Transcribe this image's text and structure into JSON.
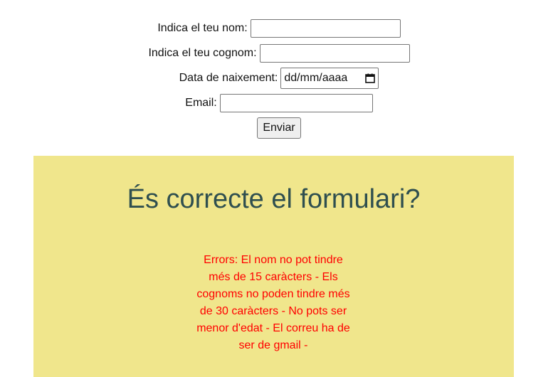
{
  "form": {
    "name_label": "Indica el teu nom:",
    "name_value": "",
    "surname_label": "Indica el teu cognom:",
    "surname_value": "",
    "birth_label": "Data de naixement:",
    "birth_placeholder": "dd/mm/aaaa",
    "email_label": "Email:",
    "email_value": "",
    "submit_label": "Enviar"
  },
  "result": {
    "title": "És correcte el formulari?",
    "errors": "Errors: El nom no pot tindre més de 15 caràcters - Els cognoms no poden tindre més de 30 caràcters - No pots ser menor d'edat - El correu ha de ser de gmail -",
    "panel_color": "#f0e68c",
    "title_color": "#2f4f4f",
    "error_color": "#ff0000"
  },
  "icons": {
    "date_picker": "calendar-icon"
  }
}
